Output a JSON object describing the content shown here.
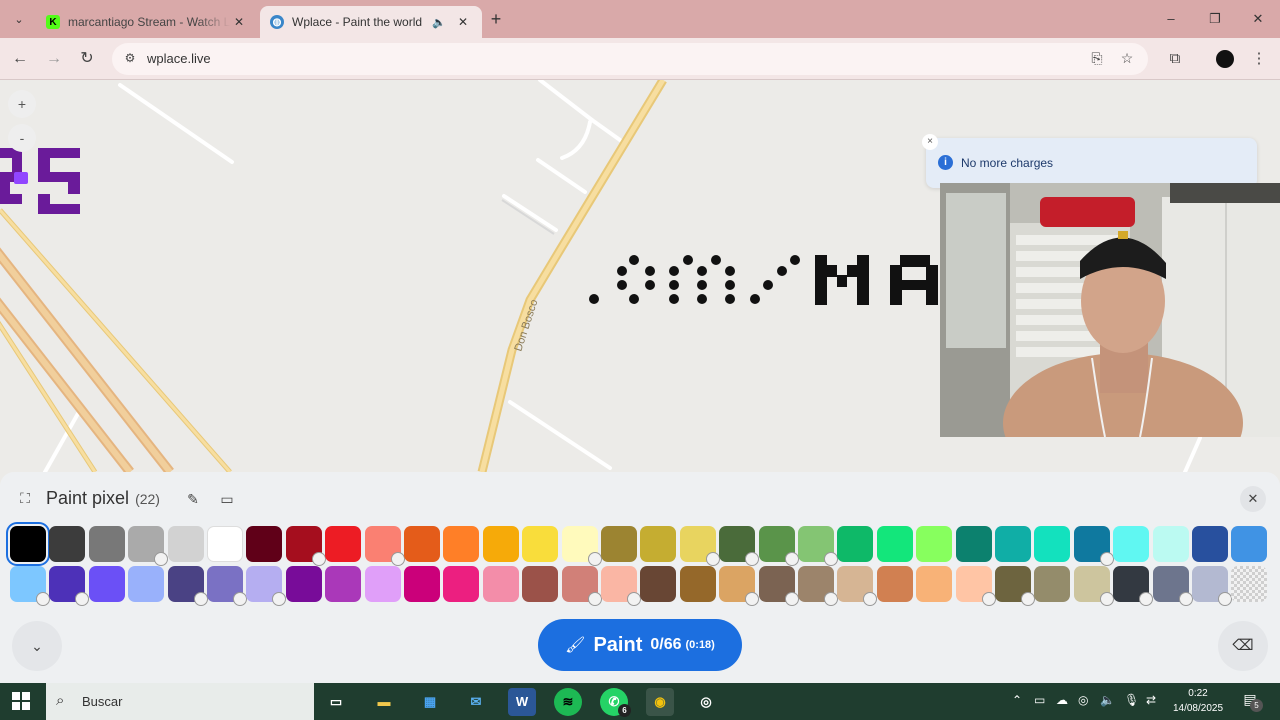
{
  "browser": {
    "tabs": [
      {
        "title": "marcantiago Stream - Watch Li",
        "favicon": "kick-icon",
        "active": false
      },
      {
        "title": "Wplace - Paint the world",
        "favicon": "globe-icon",
        "active": true
      }
    ],
    "url": "wplace.live",
    "window_controls": {
      "minimize": "–",
      "restore": "❐",
      "close": "✕"
    }
  },
  "map": {
    "zoom_in": "+",
    "zoom_out": "-",
    "street_label": "Don Bosco",
    "painted_text": ".om.ʼMA"
  },
  "toast": {
    "message": "No more charges",
    "close": "×",
    "info": "i"
  },
  "panel": {
    "title": "Paint pixel",
    "count": "(22)",
    "close": "✕",
    "paint_button": {
      "label": "Paint",
      "charges": "0/66",
      "timer": "(0:18)"
    }
  },
  "palette": {
    "rows": [
      [
        {
          "color": "#000000",
          "locked": false,
          "selected": true
        },
        {
          "color": "#3c3c3c",
          "locked": false
        },
        {
          "color": "#787878",
          "locked": false
        },
        {
          "color": "#aaaaaa",
          "locked": true
        },
        {
          "color": "#d2d2d2",
          "locked": false
        },
        {
          "color": "#ffffff",
          "locked": false
        },
        {
          "color": "#600018",
          "locked": false
        },
        {
          "color": "#a50e1e",
          "locked": true
        },
        {
          "color": "#ed1c24",
          "locked": false
        },
        {
          "color": "#fa8072",
          "locked": true
        },
        {
          "color": "#e45c1a",
          "locked": false
        },
        {
          "color": "#ff7f27",
          "locked": false
        },
        {
          "color": "#f6aa09",
          "locked": false
        },
        {
          "color": "#f9dd3b",
          "locked": false
        },
        {
          "color": "#fffabc",
          "locked": true
        },
        {
          "color": "#9c8431",
          "locked": false
        },
        {
          "color": "#c5ad31",
          "locked": false
        },
        {
          "color": "#e8d45f",
          "locked": true
        },
        {
          "color": "#4a6b3a",
          "locked": true
        },
        {
          "color": "#5a944a",
          "locked": true
        },
        {
          "color": "#84c573",
          "locked": true
        },
        {
          "color": "#0eb968",
          "locked": false
        },
        {
          "color": "#13e67b",
          "locked": false
        },
        {
          "color": "#87ff5e",
          "locked": false
        },
        {
          "color": "#0c816e",
          "locked": false
        },
        {
          "color": "#10aea6",
          "locked": false
        },
        {
          "color": "#13e1be",
          "locked": false
        },
        {
          "color": "#0f799f",
          "locked": true
        },
        {
          "color": "#60f7f2",
          "locked": false
        },
        {
          "color": "#bbfaf2",
          "locked": false
        },
        {
          "color": "#28509e",
          "locked": false
        },
        {
          "color": "#4093e4",
          "locked": false
        }
      ],
      [
        {
          "color": "#7dc7ff",
          "locked": true
        },
        {
          "color": "#4d31b8",
          "locked": true
        },
        {
          "color": "#6b50f6",
          "locked": false
        },
        {
          "color": "#99b1fb",
          "locked": false
        },
        {
          "color": "#4a4284",
          "locked": true
        },
        {
          "color": "#7a71c4",
          "locked": true
        },
        {
          "color": "#b5aef1",
          "locked": true
        },
        {
          "color": "#780c99",
          "locked": false
        },
        {
          "color": "#aa38b9",
          "locked": false
        },
        {
          "color": "#e09ff9",
          "locked": false
        },
        {
          "color": "#cb007a",
          "locked": false
        },
        {
          "color": "#ec1f80",
          "locked": false
        },
        {
          "color": "#f38da9",
          "locked": false
        },
        {
          "color": "#9b5249",
          "locked": false
        },
        {
          "color": "#d18078",
          "locked": true
        },
        {
          "color": "#fab6a4",
          "locked": true
        },
        {
          "color": "#684634",
          "locked": false
        },
        {
          "color": "#95682a",
          "locked": false
        },
        {
          "color": "#dba463",
          "locked": true
        },
        {
          "color": "#7b6352",
          "locked": true
        },
        {
          "color": "#9c846b",
          "locked": true
        },
        {
          "color": "#d6b594",
          "locked": true
        },
        {
          "color": "#d18051",
          "locked": false
        },
        {
          "color": "#f8b277",
          "locked": false
        },
        {
          "color": "#ffc5a5",
          "locked": true
        },
        {
          "color": "#6d643f",
          "locked": true
        },
        {
          "color": "#948c6b",
          "locked": false
        },
        {
          "color": "#cdc59e",
          "locked": true
        },
        {
          "color": "#333941",
          "locked": true
        },
        {
          "color": "#6d758d",
          "locked": true
        },
        {
          "color": "#b3b9d1",
          "locked": true
        },
        {
          "color": "transparent",
          "locked": false,
          "checker": true
        }
      ]
    ]
  },
  "taskbar": {
    "search_placeholder": "Buscar",
    "apps": [
      {
        "name": "task-view-icon",
        "glyph": "▭"
      },
      {
        "name": "file-explorer-icon",
        "glyph": "▬"
      },
      {
        "name": "store-icon",
        "glyph": "▦"
      },
      {
        "name": "mail-icon",
        "glyph": "✉"
      },
      {
        "name": "word-icon",
        "glyph": "W"
      },
      {
        "name": "spotify-icon",
        "glyph": "≋"
      },
      {
        "name": "whatsapp-icon",
        "glyph": "✆",
        "badge": "6"
      },
      {
        "name": "chrome-icon",
        "glyph": "◉"
      },
      {
        "name": "obs-icon",
        "glyph": "◎"
      }
    ],
    "time": "0:22",
    "date": "14/08/2025",
    "notifications": "5"
  }
}
